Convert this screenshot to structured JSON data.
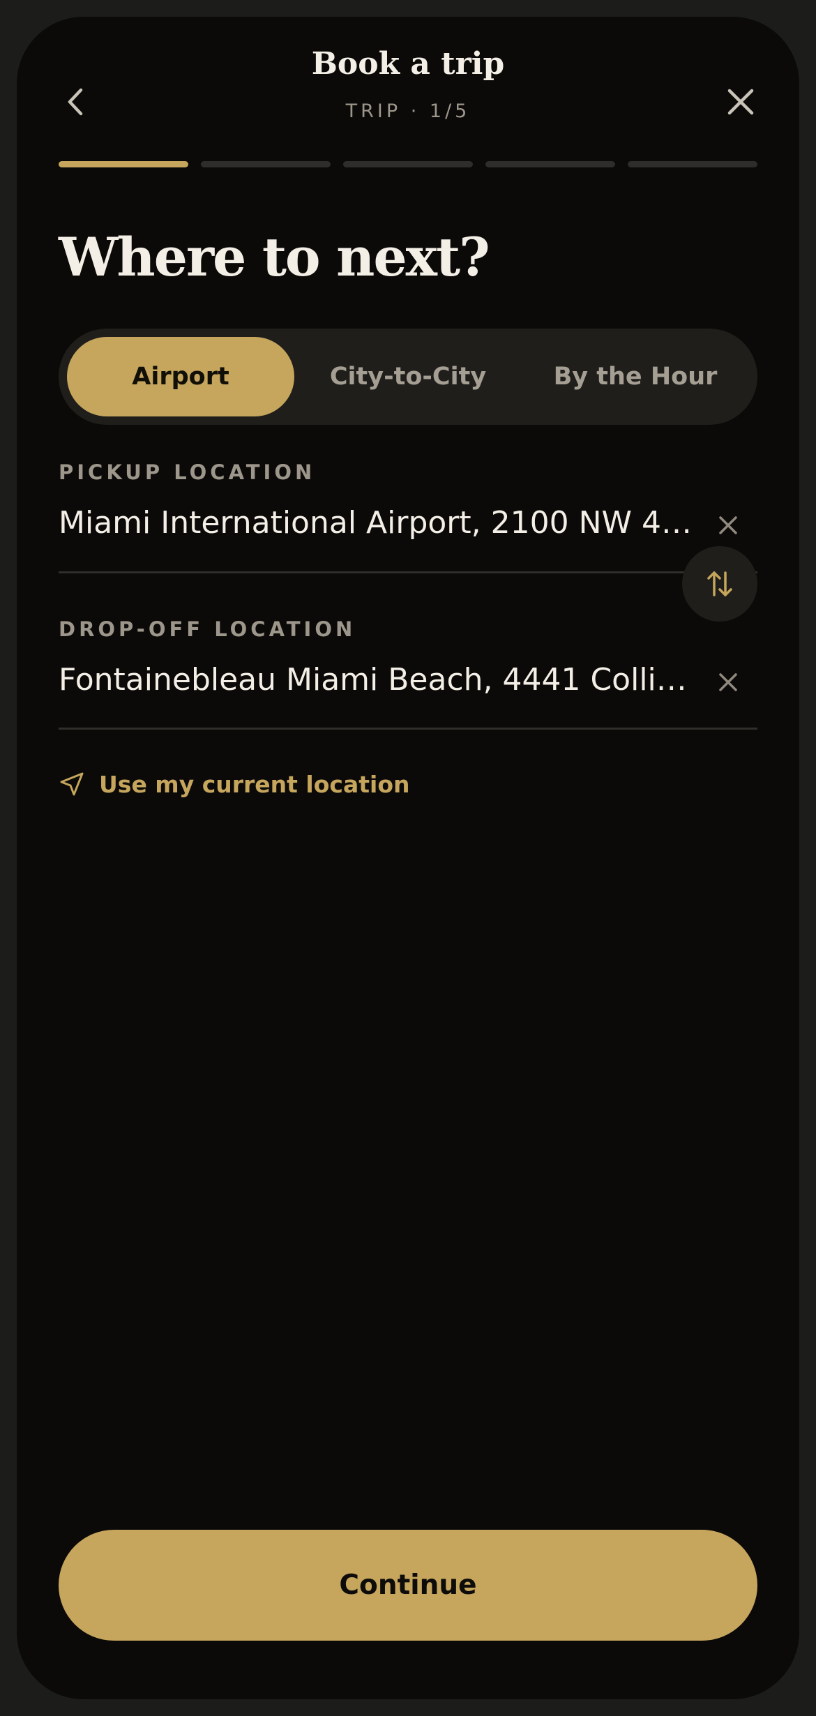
{
  "header": {
    "title": "Book a trip",
    "step": "TRIP · 1/5",
    "back_icon": "chevron-left-icon",
    "close_icon": "close-icon"
  },
  "progress": {
    "total_steps": 5,
    "current_step": 1
  },
  "heading": "Where to next?",
  "trip_types": {
    "options": [
      "Airport",
      "City-to-City",
      "By the Hour"
    ],
    "selected": "Airport"
  },
  "pickup": {
    "label": "PICKUP LOCATION",
    "value": "Miami International Airport, 2100 NW 42..."
  },
  "dropoff": {
    "label": "DROP-OFF LOCATION",
    "value": "Fontainebleau Miami Beach, 4441 Collins ..."
  },
  "swap_icon": "swap-vertical-icon",
  "current_location": {
    "label": "Use my current location",
    "icon": "navigation-arrow-icon"
  },
  "continue_label": "Continue",
  "colors": {
    "accent": "#c6a55d",
    "background": "#0b0a09",
    "text": "#f4efe6",
    "muted": "#9d968b"
  }
}
